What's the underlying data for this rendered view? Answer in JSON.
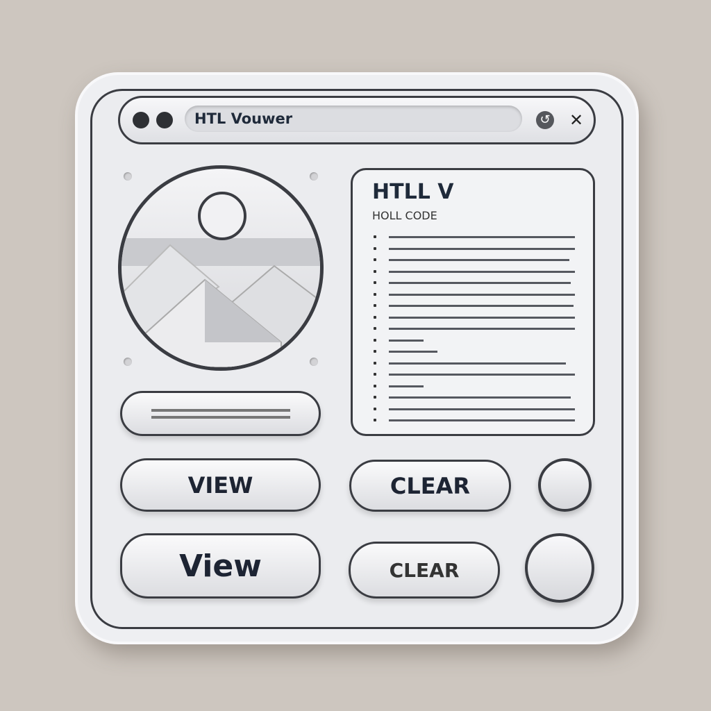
{
  "window": {
    "title": "HTL Vouwer"
  },
  "preview": {
    "image_label": "image-placeholder"
  },
  "code_panel": {
    "heading": "HTLL V",
    "subheading": "HOLL CODE"
  },
  "buttons": {
    "view_small": "VIEW",
    "clear_small": "CLEAR",
    "view_large": "View",
    "clear_large": "CLEAR"
  },
  "colors": {
    "background": "#cdc6bf",
    "card": "#eeeff2",
    "outline": "#3a3c42",
    "text": "#1d2433"
  }
}
